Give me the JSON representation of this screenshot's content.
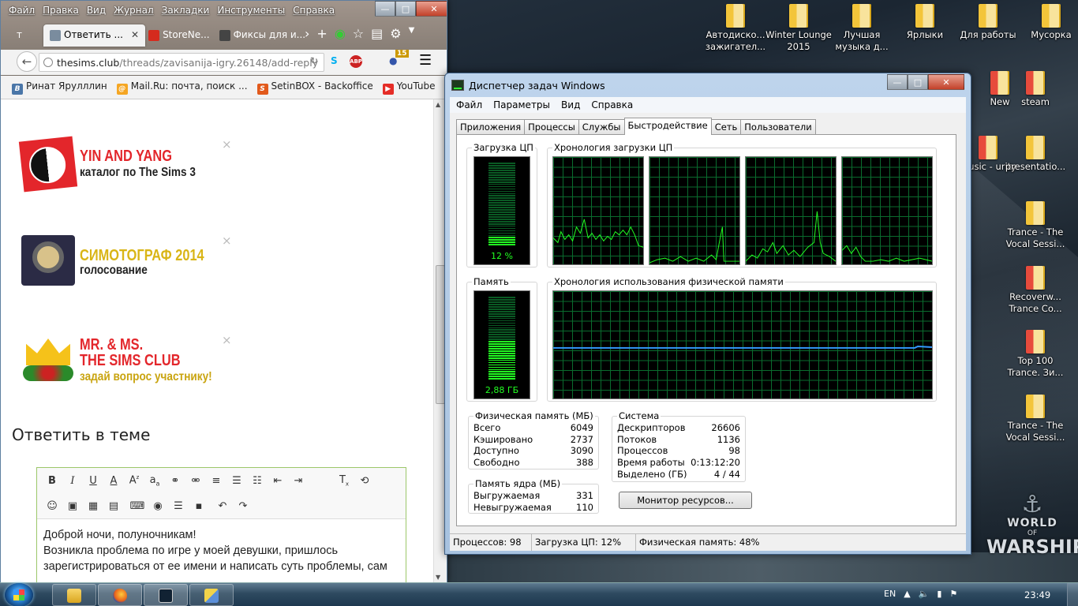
{
  "desktop": {
    "icons": [
      {
        "label": "Автодиско... зажигател...",
        "red": false
      },
      {
        "label": "Winter Lounge 2015",
        "red": false
      },
      {
        "label": "Лучшая музыка д...",
        "red": false
      },
      {
        "label": "Ярлыки",
        "red": false
      },
      {
        "label": "Для работы",
        "red": false
      },
      {
        "label": "Мусорка",
        "red": false
      },
      {
        "label": "New",
        "red": true
      },
      {
        "label": "steam",
        "red": true
      },
      {
        "label": "music - urity",
        "red": true
      },
      {
        "label": "presentatio...",
        "red": false
      },
      {
        "label": "Trance - The Vocal Sessi...",
        "red": false
      },
      {
        "label": "Recoverw... Trance Co...",
        "red": true
      },
      {
        "label": "Top 100 Trance. Зи...",
        "red": true
      },
      {
        "label": "Trance - The Vocal Sessi...",
        "red": false
      }
    ],
    "wows": {
      "top": "WORLD",
      "of": "OF",
      "bottom": "WARSHIPS"
    }
  },
  "browser": {
    "menu": [
      "Файл",
      "Правка",
      "Вид",
      "Журнал",
      "Закладки",
      "Инструменты",
      "Справка"
    ],
    "tabs": [
      {
        "label": "Ответить ...",
        "active": true,
        "color": "#7a8c9e"
      },
      {
        "label": "StoreNe...",
        "active": false,
        "color": "#d52b1e"
      },
      {
        "label": "Фиксы для и...",
        "active": false,
        "color": "#7a8c9e"
      }
    ],
    "url_host": "thesims.club",
    "url_path": "/threads/zavisanija-igry.26148/add-reply",
    "badge": "15",
    "bookmarks": [
      {
        "label": "Ринат Ярулллин",
        "color": "#4a76a8",
        "g": "B"
      },
      {
        "label": "Mail.Ru: почта, поиск ...",
        "color": "#f5a623",
        "g": "@"
      },
      {
        "label": "SetinBOX - Backoffice",
        "color": "#e25a1c",
        "g": "S"
      },
      {
        "label": "YouTube",
        "color": "#e52d27",
        "g": "▶"
      }
    ],
    "banners": [
      {
        "title": "YIN AND YANG",
        "subtitle": "каталог по The Sims 3"
      },
      {
        "title": "СИМОТОГРАФ 2014",
        "subtitle": "голосование"
      },
      {
        "title1": "MR. & MS.",
        "title2": "THE SIMS CLUB",
        "subtitle": "задай вопрос участнику!"
      }
    ],
    "close": "×",
    "reply_heading": "Ответить в теме",
    "editor_text": "Доброй ночи, полуночникам!\nВозникла проблема по игре у моей девушки, пришлось зарегистрироваться от ее имени и написать суть проблемы, сам"
  },
  "taskmgr": {
    "title": "Диспетчер задач Windows",
    "menu": [
      "Файл",
      "Параметры",
      "Вид",
      "Справка"
    ],
    "tabs": [
      "Приложения",
      "Процессы",
      "Службы",
      "Быстродействие",
      "Сеть",
      "Пользователи"
    ],
    "active_tab": "Быстродействие",
    "cpu_label": "Загрузка ЦП",
    "cpu_value": "12 %",
    "cpu_fraction": 0.12,
    "cpu_hist_label": "Хронология загрузки ЦП",
    "mem_label": "Память",
    "mem_value": "2,88 ГБ",
    "mem_fraction": 0.48,
    "mem_hist_label": "Хронология использования физической памяти",
    "phys": {
      "label": "Физическая память (МБ)",
      "rows": [
        [
          "Всего",
          "6049"
        ],
        [
          "Кэшировано",
          "2737"
        ],
        [
          "Доступно",
          "3090"
        ],
        [
          "Свободно",
          "388"
        ]
      ]
    },
    "kernel": {
      "label": "Память ядра (МБ)",
      "rows": [
        [
          "Выгружаемая",
          "331"
        ],
        [
          "Невыгружаемая",
          "110"
        ]
      ]
    },
    "system": {
      "label": "Система",
      "rows": [
        [
          "Дескрипторов",
          "26606"
        ],
        [
          "Потоков",
          "1136"
        ],
        [
          "Процессов",
          "98"
        ],
        [
          "Время работы",
          "0:13:12:20"
        ],
        [
          "Выделено (ГБ)",
          "4 / 44"
        ]
      ]
    },
    "resmon_button": "Монитор ресурсов...",
    "status": [
      "Процессов: 98",
      "Загрузка ЦП: 12%",
      "Физическая память: 48%"
    ]
  },
  "taskbar": {
    "lang": "EN",
    "time": "23:49"
  }
}
